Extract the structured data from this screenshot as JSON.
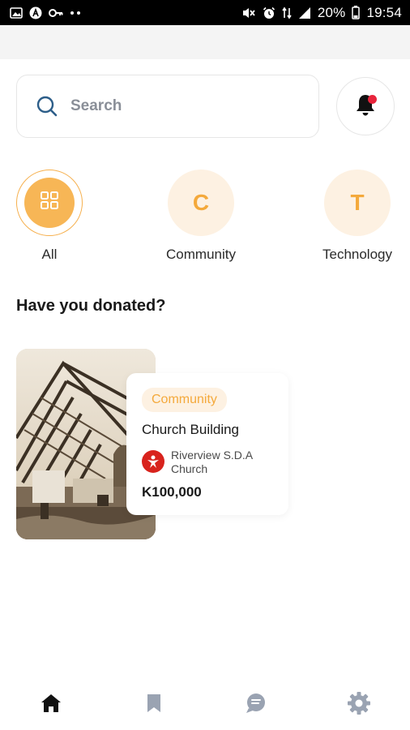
{
  "status_bar": {
    "battery": "20%",
    "time": "19:54"
  },
  "search": {
    "placeholder": "Search"
  },
  "categories": [
    {
      "label": "All",
      "letter": "",
      "active": true
    },
    {
      "label": "Community",
      "letter": "C",
      "active": false
    },
    {
      "label": "Technology",
      "letter": "T",
      "active": false
    }
  ],
  "section": {
    "title": "Have you donated?"
  },
  "card": {
    "badge": "Community",
    "title": "Church Building",
    "organization": "Riverview S.D.A Church",
    "amount": "K100,000"
  },
  "colors": {
    "accent": "#f4a93b",
    "accent_light": "#fdf1e2",
    "notification_dot": "#e8243c",
    "org_logo": "#d8231d",
    "nav_active": "#111111",
    "nav_inactive": "#9aa3b2"
  },
  "bottom_nav": [
    {
      "icon": "home-icon",
      "active": true
    },
    {
      "icon": "bookmark-icon",
      "active": false
    },
    {
      "icon": "chat-icon",
      "active": false
    },
    {
      "icon": "gear-icon",
      "active": false
    }
  ]
}
